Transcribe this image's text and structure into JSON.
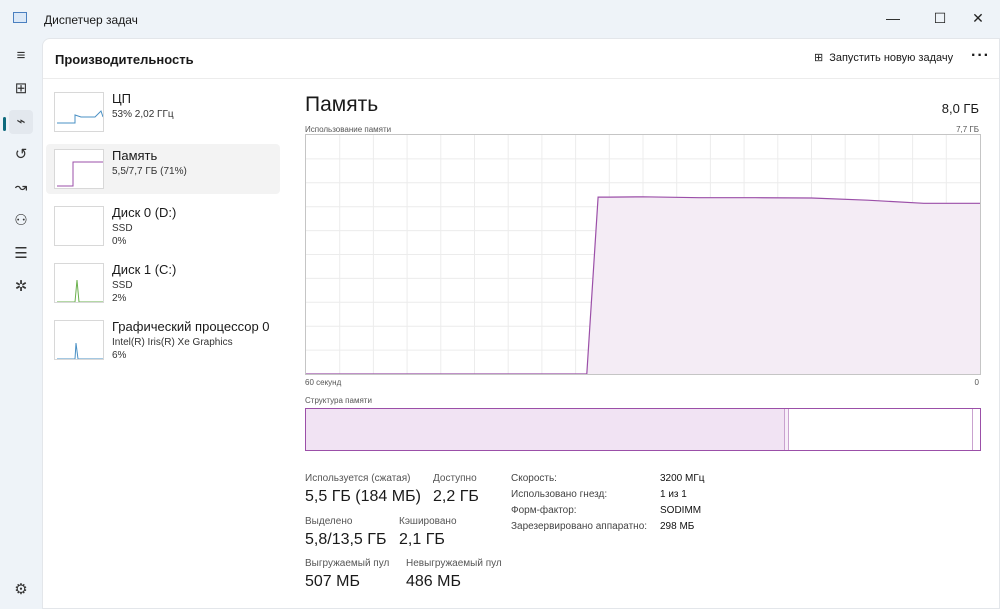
{
  "window": {
    "title": "Диспетчер задач",
    "minimize": "—",
    "maximize": "☐",
    "close": "✕"
  },
  "nav": {
    "items": [
      "menu-icon",
      "processes-icon",
      "performance-icon",
      "app-history-icon",
      "startup-icon",
      "users-icon",
      "details-icon",
      "services-icon",
      "settings-icon"
    ]
  },
  "header": {
    "title": "Производительность",
    "run_task": "Запустить новую задачу",
    "more": "···"
  },
  "sidebar": {
    "items": [
      {
        "name": "ЦП",
        "sub1": "53% 2,02 ГГц",
        "sub2": "",
        "color": "#4a90c4"
      },
      {
        "name": "Память",
        "sub1": "5,5/7,7 ГБ (71%)",
        "sub2": "",
        "color": "#9b4fa8"
      },
      {
        "name": "Диск 0 (D:)",
        "sub1": "SSD",
        "sub2": "0%",
        "color": "#6ab04c"
      },
      {
        "name": "Диск 1 (C:)",
        "sub1": "SSD",
        "sub2": "2%",
        "color": "#6ab04c"
      },
      {
        "name": "Графический процессор 0",
        "sub1": "Intel(R) Iris(R) Xe Graphics",
        "sub2": "6%",
        "color": "#4a90c4"
      }
    ]
  },
  "panel": {
    "title": "Память",
    "total": "8,0 ГБ",
    "usage_label": "Использование памяти",
    "usage_max": "7,7 ГБ",
    "time_left": "60 секунд",
    "time_right": "0",
    "composition_label": "Структура памяти"
  },
  "chart_data": {
    "type": "area",
    "title": "Использование памяти",
    "xlabel": "секунды",
    "ylabel": "ГБ",
    "xlim": [
      60,
      0
    ],
    "ylim": [
      0,
      7.7
    ],
    "x": [
      60,
      35,
      34,
      33,
      30,
      25,
      20,
      15,
      10,
      5,
      0
    ],
    "values": [
      0,
      0,
      5.7,
      5.7,
      5.71,
      5.68,
      5.68,
      5.67,
      5.6,
      5.5,
      5.5
    ],
    "color": "#9b4fa8"
  },
  "composition": {
    "in_use": 71,
    "modified": 0.6,
    "standby": 27.4,
    "free": 1
  },
  "stats": {
    "in_use_label": "Используется (сжатая)",
    "in_use": "5,5 ГБ (184 МБ)",
    "available_label": "Доступно",
    "available": "2,2 ГБ",
    "committed_label": "Выделено",
    "committed": "5,8/13,5 ГБ",
    "cached_label": "Кэшировано",
    "cached": "2,1 ГБ",
    "paged_label": "Выгружаемый пул",
    "paged": "507 МБ",
    "nonpaged_label": "Невыгружаемый пул",
    "nonpaged": "486 МБ"
  },
  "props": [
    {
      "k": "Скорость:",
      "v": "3200 МГц"
    },
    {
      "k": "Использовано гнезд:",
      "v": "1 из 1"
    },
    {
      "k": "Форм-фактор:",
      "v": "SODIMM"
    },
    {
      "k": "Зарезервировано аппаратно:",
      "v": "298 МБ"
    }
  ]
}
